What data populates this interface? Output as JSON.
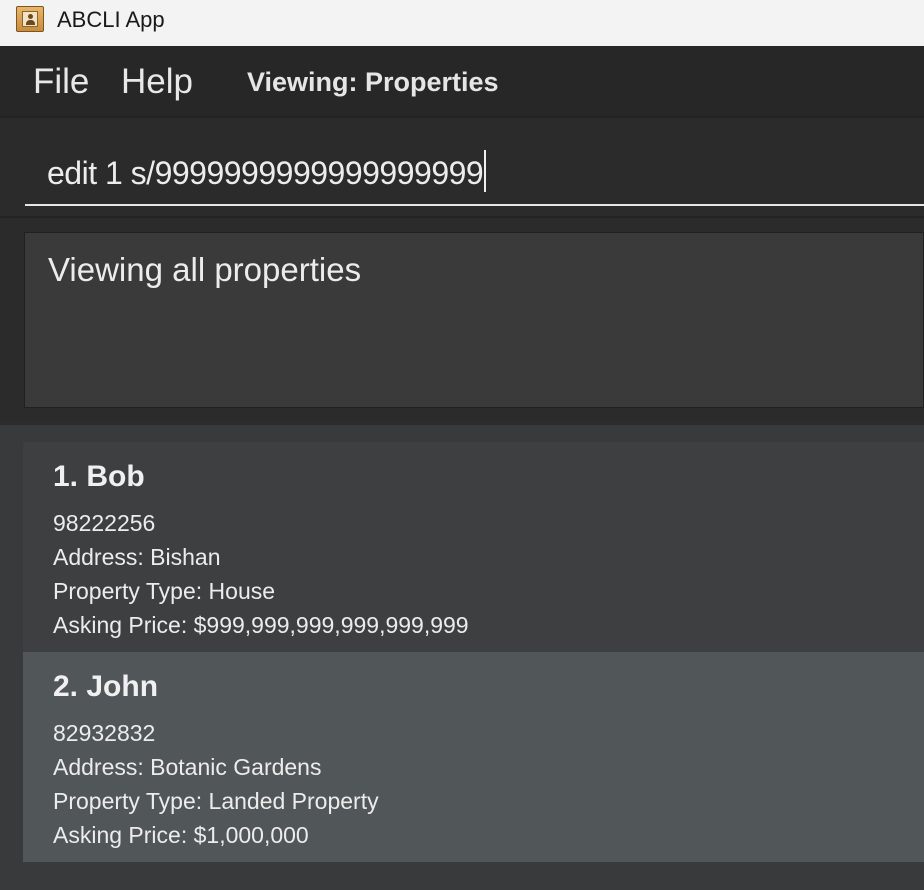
{
  "window": {
    "title": "ABCLI App",
    "icon": "address-book-icon"
  },
  "menu": {
    "file": "File",
    "help": "Help",
    "viewing": "Viewing: Properties"
  },
  "command": {
    "value": "edit 1 s/9999999999999999999"
  },
  "result": {
    "text": "Viewing all properties"
  },
  "properties": [
    {
      "title": "1. Bob",
      "phone": "98222256",
      "address": "Address: Bishan",
      "type": "Property Type: House",
      "price": "Asking Price: $999,999,999,999,999,999"
    },
    {
      "title": "2. John",
      "phone": "82932832",
      "address": "Address: Botanic Gardens",
      "type": "Property Type: Landed Property",
      "price": "Asking Price: $1,000,000"
    }
  ],
  "colors": {
    "titlebar": "#f3f3f3",
    "menubar": "#272727",
    "background": "#2b2b2b",
    "card_default": "#3e3f41",
    "card_selected": "#515658",
    "text": "#ececec"
  }
}
